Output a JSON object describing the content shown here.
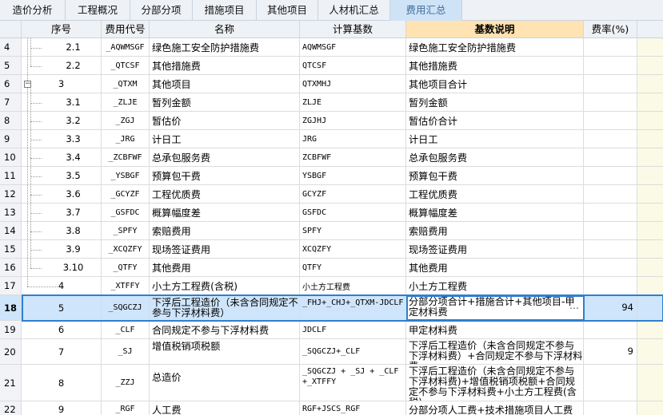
{
  "tabs": [
    {
      "label": "造价分析",
      "active": false
    },
    {
      "label": "工程概况",
      "active": false
    },
    {
      "label": "分部分项",
      "active": false
    },
    {
      "label": "措施项目",
      "active": false
    },
    {
      "label": "其他项目",
      "active": false
    },
    {
      "label": "人材机汇总",
      "active": false
    },
    {
      "label": "费用汇总",
      "active": true
    }
  ],
  "columns": {
    "seq": "序号",
    "code": "费用代号",
    "name": "名称",
    "base": "计算基数",
    "desc": "基数说明",
    "rate": "费率(%)"
  },
  "rows": [
    {
      "num": "4",
      "seq": "2.1",
      "code": "_AQWMSGF",
      "name": "绿色施工安全防护措施费",
      "base": "AQWMSGF",
      "desc": "绿色施工安全防护措施费",
      "rate": ""
    },
    {
      "num": "5",
      "seq": "2.2",
      "code": "_QTCSF",
      "name": "其他措施费",
      "base": "QTCSF",
      "desc": "其他措施费",
      "rate": ""
    },
    {
      "num": "6",
      "seq": "3",
      "code": "_QTXM",
      "name": "其他项目",
      "base": "QTXMHJ",
      "desc": "其他项目合计",
      "rate": ""
    },
    {
      "num": "7",
      "seq": "3.1",
      "code": "_ZLJE",
      "name": "暂列金额",
      "base": "ZLJE",
      "desc": "暂列金额",
      "rate": ""
    },
    {
      "num": "8",
      "seq": "3.2",
      "code": "_ZGJ",
      "name": "暂估价",
      "base": "ZGJHJ",
      "desc": "暂估价合计",
      "rate": ""
    },
    {
      "num": "9",
      "seq": "3.3",
      "code": "_JRG",
      "name": "计日工",
      "base": "JRG",
      "desc": "计日工",
      "rate": ""
    },
    {
      "num": "10",
      "seq": "3.4",
      "code": "_ZCBFWF",
      "name": "总承包服务费",
      "base": "ZCBFWF",
      "desc": "总承包服务费",
      "rate": ""
    },
    {
      "num": "11",
      "seq": "3.5",
      "code": "_YSBGF",
      "name": "预算包干费",
      "base": "YSBGF",
      "desc": "预算包干费",
      "rate": ""
    },
    {
      "num": "12",
      "seq": "3.6",
      "code": "_GCYZF",
      "name": "工程优质费",
      "base": "GCYZF",
      "desc": "工程优质费",
      "rate": ""
    },
    {
      "num": "13",
      "seq": "3.7",
      "code": "_GSFDC",
      "name": "概算幅度差",
      "base": "GSFDC",
      "desc": "概算幅度差",
      "rate": ""
    },
    {
      "num": "14",
      "seq": "3.8",
      "code": "_SPFY",
      "name": "索赔费用",
      "base": "SPFY",
      "desc": "索赔费用",
      "rate": ""
    },
    {
      "num": "15",
      "seq": "3.9",
      "code": "_XCQZFY",
      "name": "现场签证费用",
      "base": "XCQZFY",
      "desc": "现场签证费用",
      "rate": ""
    },
    {
      "num": "16",
      "seq": "3.10",
      "code": "_QTFY",
      "name": "其他费用",
      "base": "QTFY",
      "desc": "其他费用",
      "rate": ""
    },
    {
      "num": "17",
      "seq": "4",
      "code": "_XTFFY",
      "name": "小土方工程费(含税)",
      "base": "小土方工程费",
      "desc": "小土方工程费",
      "rate": ""
    },
    {
      "num": "18",
      "seq": "5",
      "code": "_SQGCZJ",
      "name": "下浮后工程造价（未含合同规定不参与下浮材料费）",
      "base": "_FHJ+_CHJ+_QTXM-JDCLF",
      "desc": "分部分项合计+措施合计+其他项目-甲定材料费",
      "rate": "94"
    },
    {
      "num": "19",
      "seq": "6",
      "code": "_CLF",
      "name": "合同规定不参与下浮材料费",
      "base": "JDCLF",
      "desc": "甲定材料费",
      "rate": ""
    },
    {
      "num": "20",
      "seq": "7",
      "code": "_SJ",
      "name": "增值税销项税额",
      "base": "_SQGCZJ+_CLF",
      "desc": "下浮后工程造价（未含合同规定不参与下浮材料费）+合同规定不参与下浮材料费",
      "rate": "9"
    },
    {
      "num": "21",
      "seq": "8",
      "code": "_ZZJ",
      "name": "总造价",
      "base": "_SQGCZJ + _SJ + _CLF +_XTFFY",
      "desc": "下浮后工程造价（未含合同规定不参与下浮材料费)+增值税销项税额+合同规定不参与下浮材料费+小土方工程费(含税)",
      "rate": ""
    },
    {
      "num": "22",
      "seq": "9",
      "code": "_RGF",
      "name": "人工费",
      "base": "RGF+JSCS_RGF",
      "desc": "分部分项人工费+技术措施项目人工费",
      "rate": ""
    }
  ]
}
